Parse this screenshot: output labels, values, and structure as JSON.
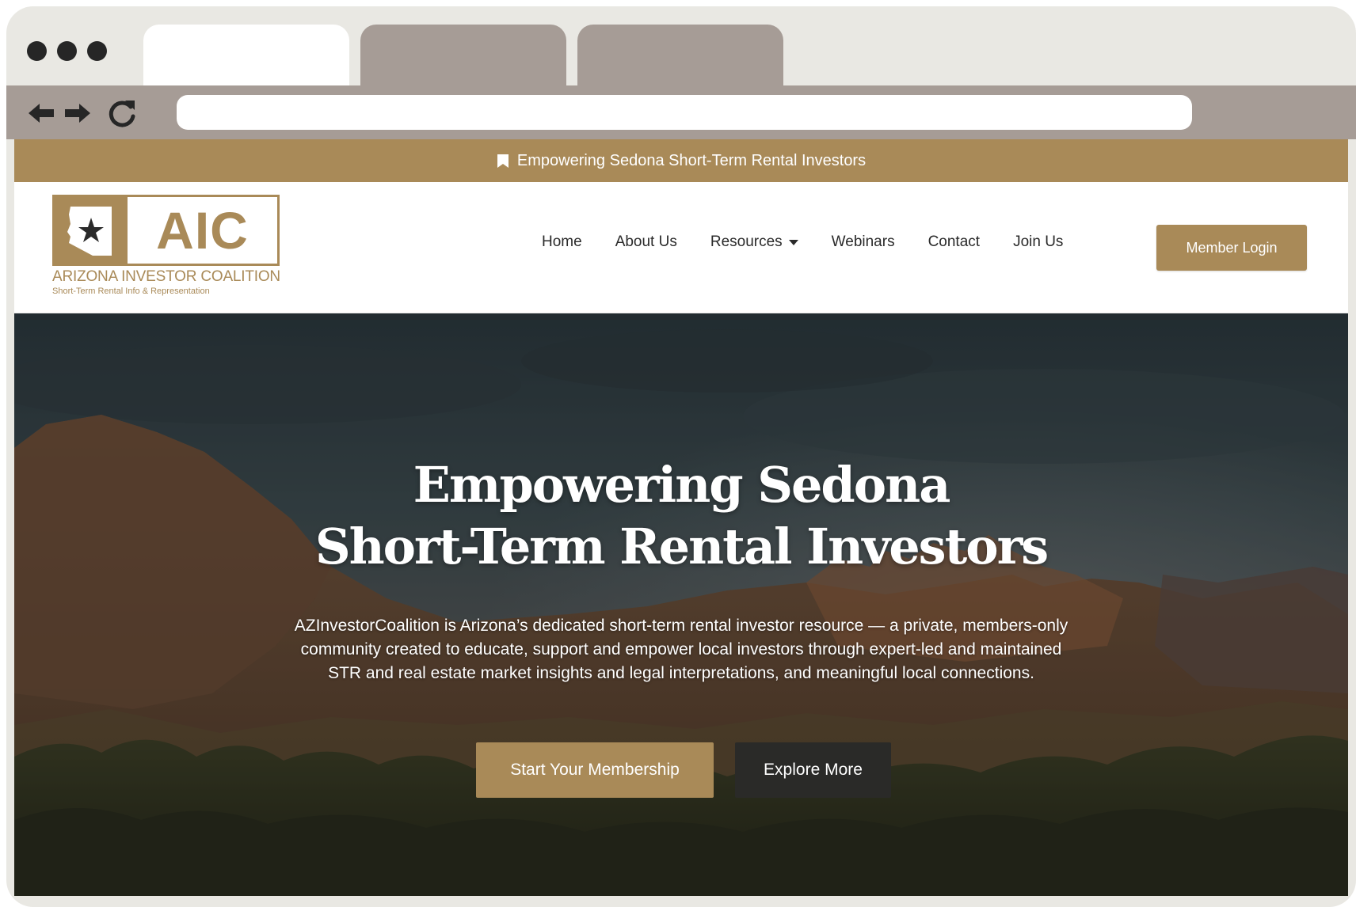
{
  "browser": {
    "address_value": "",
    "colors": {
      "frame": "#e9e8e3",
      "toolbar": "#a69c96",
      "inactive_tab": "#a69c96"
    },
    "icons": {
      "back": "arrow-left-icon",
      "forward": "arrow-right-icon",
      "reload": "reload-icon"
    }
  },
  "announcement": {
    "text": "Empowering Sedona Short-Term Rental Investors",
    "icon": "bookmark-icon"
  },
  "logo": {
    "letters": "AIC",
    "name": "ARIZONA INVESTOR COALITION",
    "tagline": "Short-Term Rental Info & Representation"
  },
  "nav": {
    "items": [
      {
        "label": "Home"
      },
      {
        "label": "About Us"
      },
      {
        "label": "Resources"
      },
      {
        "label": "Webinars"
      },
      {
        "label": "Contact"
      },
      {
        "label": "Join Us"
      }
    ],
    "login_label": "Member Login"
  },
  "hero": {
    "title_line1": "Empowering Sedona",
    "title_line2": "Short-Term Rental Investors",
    "description": "AZInvestorCoalition is Arizona’s dedicated short-term rental investor resource — a private, members-only community created to educate, support and empower local investors through expert-led and maintained STR and real estate market insights and legal interpretations, and meaningful local connections.",
    "primary_cta": "Start Your Membership",
    "secondary_cta": "Explore More"
  },
  "colors": {
    "brand_gold": "#a98a58",
    "dark_button": "#2a2a28",
    "text_dark": "#2a2a2a"
  }
}
